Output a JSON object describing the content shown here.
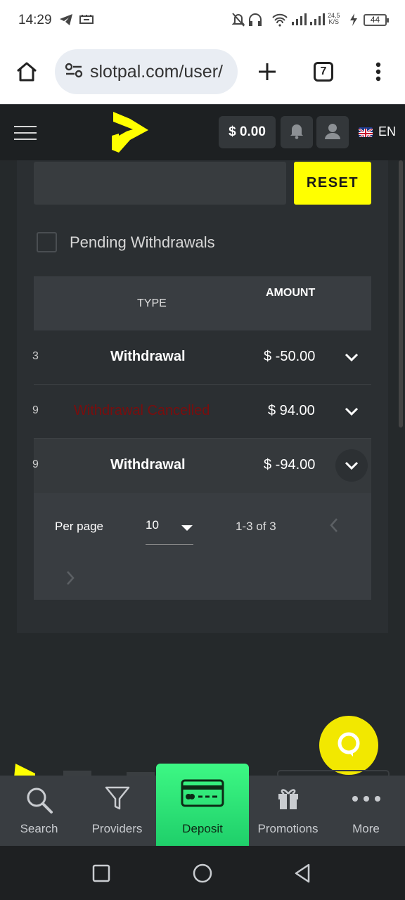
{
  "status_bar": {
    "time": "14:29",
    "network_speed_value": "24,5",
    "network_speed_unit": "K/S",
    "battery": "44"
  },
  "browser": {
    "url": "slotpal.com/user/",
    "tab_count": "7"
  },
  "header": {
    "balance": "$ 0.00",
    "language": "EN"
  },
  "filters": {
    "search_value": "",
    "reset_label": "RESET",
    "pending_label": "Pending Withdrawals"
  },
  "table": {
    "columns": {
      "type": "TYPE",
      "amount": "AMOUNT"
    },
    "rows": [
      {
        "clip": "3",
        "type": "Withdrawal",
        "amount": "$ -50.00",
        "status": "normal"
      },
      {
        "clip": "9",
        "type": "Withdrawal Cancelled",
        "amount": "$ 94.00",
        "status": "cancelled"
      },
      {
        "clip": "9",
        "type": "Withdrawal",
        "amount": "$ -94.00",
        "status": "normal"
      }
    ]
  },
  "pagination": {
    "per_page_label": "Per page",
    "per_page_value": "10",
    "range": "1-3 of 3"
  },
  "bottom_nav": {
    "items": [
      {
        "label": "Search",
        "icon": "search-icon"
      },
      {
        "label": "Providers",
        "icon": "filter-icon"
      },
      {
        "label": "Deposit",
        "icon": "credit-card-icon"
      },
      {
        "label": "Promotions",
        "icon": "gift-icon"
      },
      {
        "label": "More",
        "icon": "more-dots-icon"
      }
    ]
  },
  "colors": {
    "accent_yellow": "#ffff00",
    "deposit_green": "#2ee870",
    "cancelled_red": "#7b0d0d",
    "background": "#25292b"
  }
}
